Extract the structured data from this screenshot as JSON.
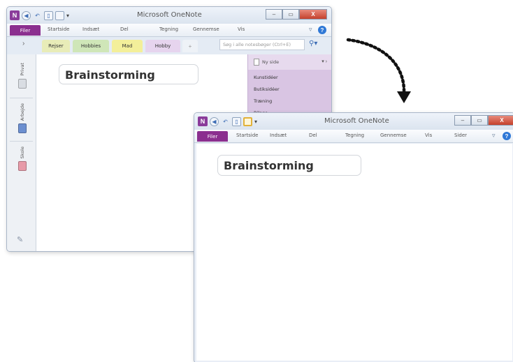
{
  "app_title": "Microsoft OneNote",
  "logo_letter": "N",
  "ribbon_tabs": [
    "Filer",
    "Startside",
    "Indsæt",
    "Del",
    "Tegning",
    "Gennemse",
    "Vis"
  ],
  "ribbon_tabs_win2": [
    "Filer",
    "Startside",
    "Indsæt",
    "Del",
    "Tegning",
    "Gennemse",
    "Vis",
    "Sider"
  ],
  "help_glyph": "?",
  "window_controls": {
    "min": "–",
    "max": "▭",
    "close": "X"
  },
  "sections": [
    {
      "label": "Rejser",
      "color": "#e8ecb8"
    },
    {
      "label": "Hobbies",
      "color": "#cfe6b8"
    },
    {
      "label": "Mad",
      "color": "#f3ef9a"
    },
    {
      "label": "Hobby",
      "color": "#e6d4ee"
    }
  ],
  "new_section_glyph": "+",
  "search_placeholder": "Søg i alle notesbøger (Ctrl+E)",
  "notebooks": [
    {
      "label": "Privat",
      "color": "#d9dde3"
    },
    {
      "label": "Arbejde",
      "color": "#6c8fd0"
    },
    {
      "label": "Skole",
      "color": "#e79aa8"
    }
  ],
  "page_pane": {
    "new_page_label": "Ny side",
    "pages": [
      "Kunstidéer",
      "Butiksidéer",
      "Træning",
      "Bilage"
    ]
  },
  "page_title": "Brainstorming",
  "icons": {
    "onenote_logo": "onenote-logo-icon",
    "back": "back-icon",
    "undo": "undo-icon",
    "dock": "dock-to-desktop-icon",
    "full_page": "full-page-view-icon",
    "customize": "customize-qat-icon",
    "expand_ribbon": "expand-ribbon-icon",
    "search": "search-icon",
    "expand_nav": "expand-navigation-icon",
    "arrow": "curved-dotted-arrow-icon"
  }
}
